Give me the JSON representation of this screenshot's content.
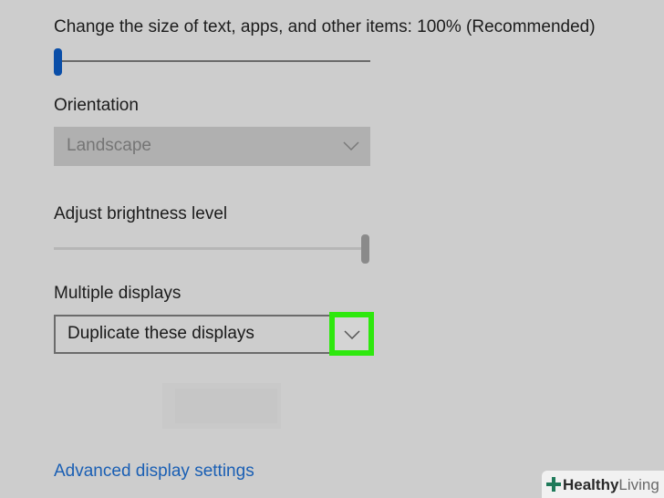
{
  "scale": {
    "label": "Change the size of text, apps, and other items: 100% (Recommended)",
    "value": 0
  },
  "orientation": {
    "label": "Orientation",
    "selected": "Landscape",
    "disabled": true
  },
  "brightness": {
    "label": "Adjust brightness level",
    "value": 1.0
  },
  "multiple_displays": {
    "label": "Multiple displays",
    "selected": "Duplicate these displays"
  },
  "advanced_link": "Advanced display settings",
  "watermark": {
    "brand_bold": "Healthy",
    "brand_light": "Living"
  },
  "colors": {
    "background": "#cdcdcd",
    "accent": "#0a4ea8",
    "highlight": "#2ee80e",
    "link": "#1a5fb4"
  },
  "icons": {
    "dropdown": "chevron-down-icon",
    "watermark_logo": "plus-cross-icon"
  }
}
